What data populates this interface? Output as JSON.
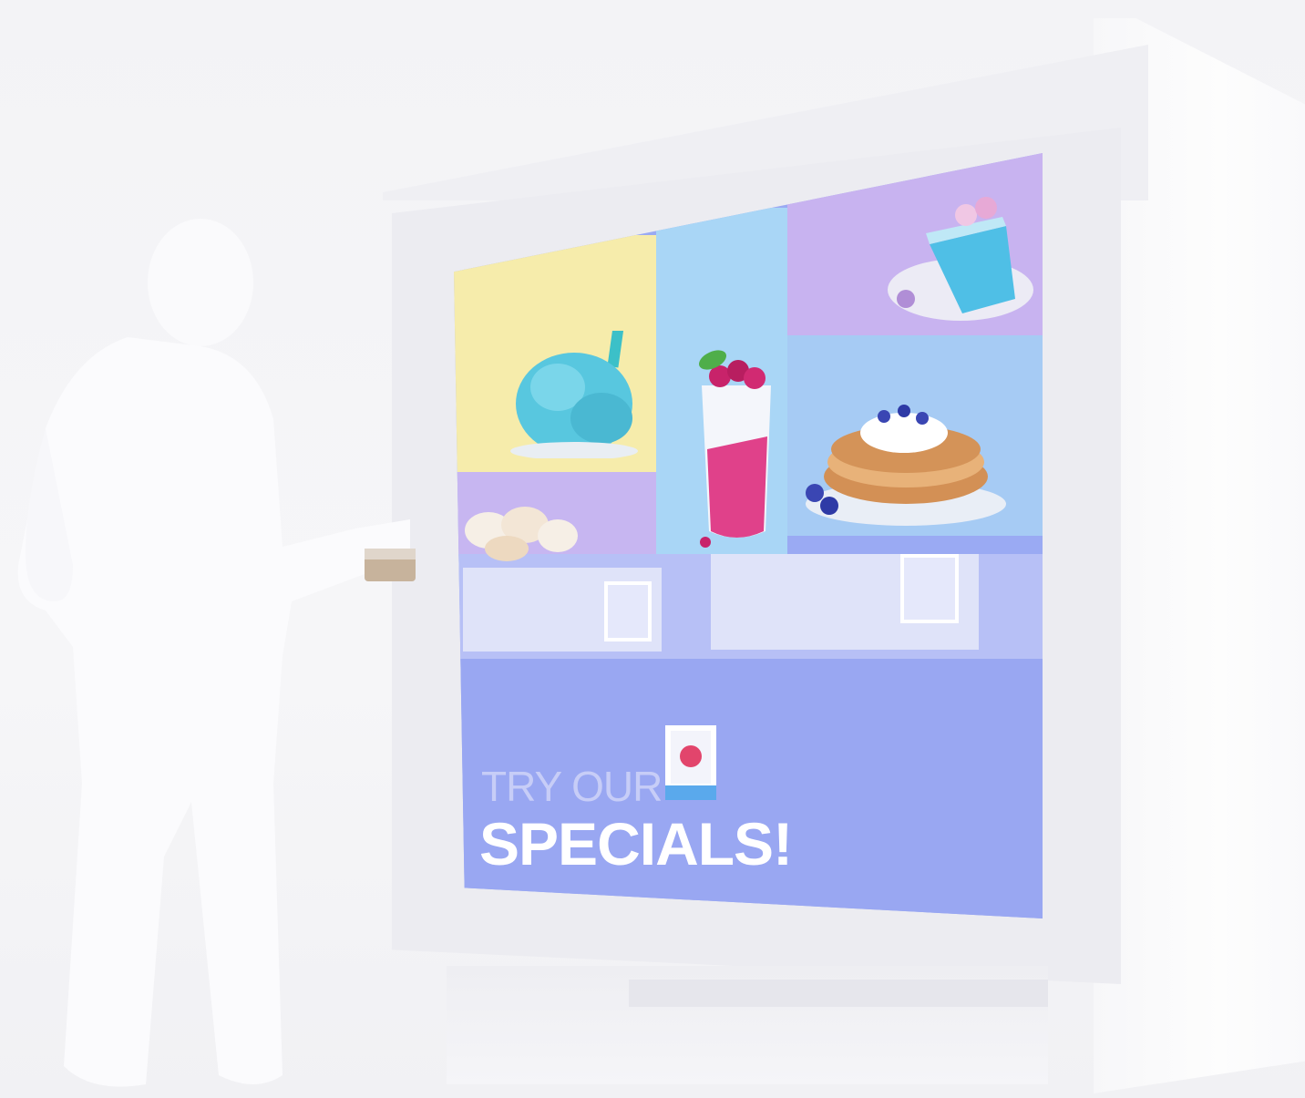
{
  "promo": {
    "line1": "TRY OUR",
    "line2": "SPECIALS!"
  },
  "icons": {
    "promo_icon": "strawberry-badge-icon",
    "qr_left": "qr-code-icon",
    "qr_right": "qr-code-icon"
  },
  "colors": {
    "screen_primary": "#99a7f2",
    "tile_yellow": "#f6ecab",
    "tile_lilac": "#c8b3f0",
    "tile_sky": "#a9d6f6",
    "text_white": "#ffffff"
  },
  "scene": {
    "subjects": [
      "person",
      "kiosk",
      "digital-menu-screen"
    ],
    "foods": [
      "blue-ice-cream",
      "berry-smoothie",
      "blue-cake",
      "blueberry-pancakes",
      "donuts"
    ]
  }
}
